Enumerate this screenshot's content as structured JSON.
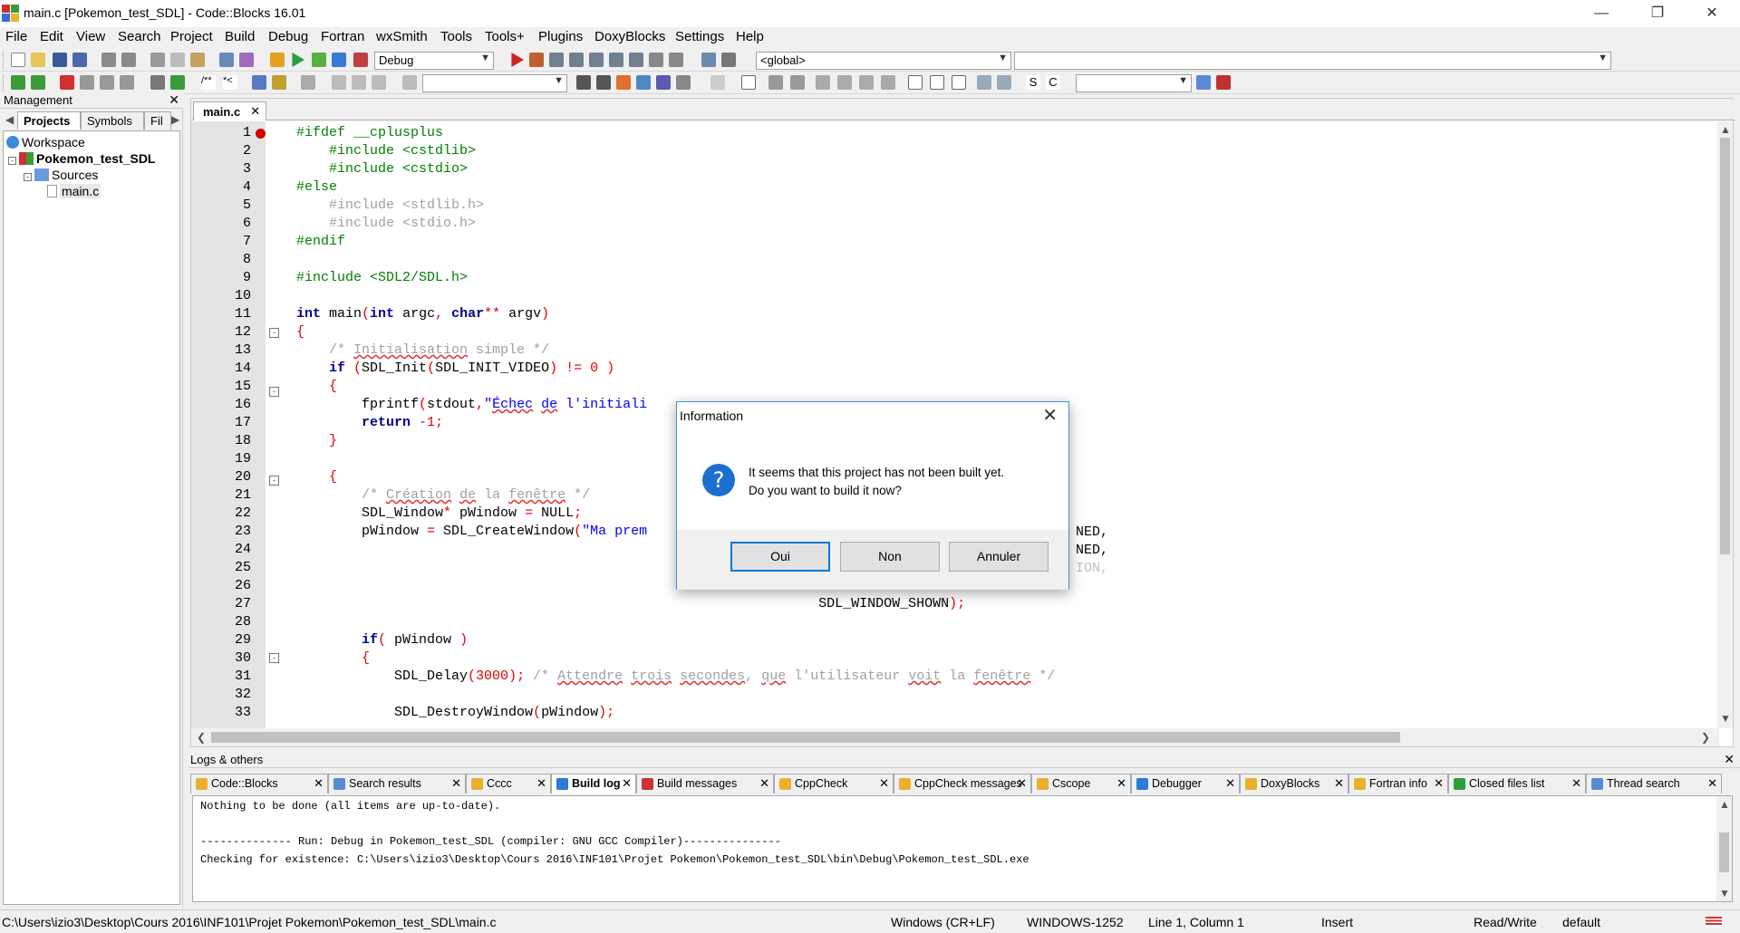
{
  "window": {
    "title": "main.c [Pokemon_test_SDL] - Code::Blocks 16.01"
  },
  "menu": [
    "File",
    "Edit",
    "View",
    "Search",
    "Project",
    "Build",
    "Debug",
    "Fortran",
    "wxSmith",
    "Tools",
    "Tools+",
    "Plugins",
    "DoxyBlocks",
    "Settings",
    "Help"
  ],
  "toolbar": {
    "build_target": "Debug",
    "scope": "<global>",
    "symbol": "",
    "search_combo": "",
    "jump_combo": ""
  },
  "management": {
    "title": "Management",
    "tabs": [
      "Projects",
      "Symbols",
      "Fil"
    ],
    "tree": {
      "workspace": "Workspace",
      "project": "Pokemon_test_SDL",
      "folder": "Sources",
      "file": "main.c"
    }
  },
  "editor": {
    "tab": "main.c",
    "lines": [
      {
        "n": "1",
        "code": [
          [
            "pp",
            "#ifdef __cplusplus"
          ]
        ]
      },
      {
        "n": "2",
        "code": [
          [
            "pp",
            "    #include <cstdlib>"
          ]
        ]
      },
      {
        "n": "3",
        "code": [
          [
            "pp",
            "    #include <cstdio>"
          ]
        ]
      },
      {
        "n": "4",
        "code": [
          [
            "pp",
            "#else"
          ]
        ]
      },
      {
        "n": "5",
        "code": [
          [
            "ppd",
            "    #include <stdlib.h>"
          ]
        ]
      },
      {
        "n": "6",
        "code": [
          [
            "ppd",
            "    #include <stdio.h>"
          ]
        ]
      },
      {
        "n": "7",
        "code": [
          [
            "pp",
            "#endif"
          ]
        ]
      },
      {
        "n": "8",
        "code": []
      },
      {
        "n": "9",
        "code": [
          [
            "pp",
            "#include <SDL2/SDL.h>"
          ]
        ]
      },
      {
        "n": "10",
        "code": []
      },
      {
        "n": "11",
        "code": [
          [
            "kw",
            "int"
          ],
          [
            "id",
            " main"
          ],
          [
            "op",
            "("
          ],
          [
            "kw",
            "int"
          ],
          [
            "id",
            " argc"
          ],
          [
            "op",
            ", "
          ],
          [
            "kw",
            "char"
          ],
          [
            "op",
            "**"
          ],
          [
            "id",
            " argv"
          ],
          [
            "op",
            ")"
          ]
        ]
      },
      {
        "n": "12",
        "code": [
          [
            "op",
            "{"
          ]
        ]
      },
      {
        "n": "13",
        "code": [
          [
            "com",
            "    /* "
          ],
          [
            "com sq",
            "Initialisation"
          ],
          [
            "com",
            " simple */"
          ]
        ]
      },
      {
        "n": "14",
        "code": [
          [
            "id",
            "    "
          ],
          [
            "kw",
            "if"
          ],
          [
            "op",
            " ("
          ],
          [
            "id",
            "SDL_Init"
          ],
          [
            "op",
            "("
          ],
          [
            "id",
            "SDL_INIT_VIDEO"
          ],
          [
            "op",
            ") != "
          ],
          [
            "num",
            "0"
          ],
          [
            "op",
            " )"
          ]
        ]
      },
      {
        "n": "15",
        "code": [
          [
            "op",
            "    {"
          ]
        ]
      },
      {
        "n": "16",
        "code": [
          [
            "id",
            "        fprintf"
          ],
          [
            "op",
            "("
          ],
          [
            "id",
            "stdout"
          ],
          [
            "op",
            ","
          ],
          [
            "str",
            "\""
          ],
          [
            "str sq",
            "Échec"
          ],
          [
            "str",
            " "
          ],
          [
            "str sq",
            "de"
          ],
          [
            "str",
            " l'initiali"
          ]
        ]
      },
      {
        "n": "17",
        "code": [
          [
            "id",
            "        "
          ],
          [
            "kw",
            "return"
          ],
          [
            "op",
            " -"
          ],
          [
            "num",
            "1"
          ],
          [
            "op",
            ";"
          ]
        ]
      },
      {
        "n": "18",
        "code": [
          [
            "op",
            "    }"
          ]
        ]
      },
      {
        "n": "19",
        "code": []
      },
      {
        "n": "20",
        "code": [
          [
            "op",
            "    {"
          ]
        ]
      },
      {
        "n": "21",
        "code": [
          [
            "com",
            "        /* "
          ],
          [
            "com sq",
            "Création"
          ],
          [
            "com",
            " "
          ],
          [
            "com sq",
            "de"
          ],
          [
            "com",
            " la "
          ],
          [
            "com sq",
            "fenêtre"
          ],
          [
            "com",
            " */"
          ]
        ]
      },
      {
        "n": "22",
        "code": [
          [
            "id",
            "        SDL_Window"
          ],
          [
            "op",
            "*"
          ],
          [
            "id",
            " pWindow "
          ],
          [
            "op",
            "="
          ],
          [
            "id",
            " NULL"
          ],
          [
            "op",
            ";"
          ]
        ]
      },
      {
        "n": "23",
        "code": [
          [
            "id",
            "        pWindow "
          ],
          [
            "op",
            "="
          ],
          [
            "id",
            " SDL_CreateWindow"
          ],
          [
            "op",
            "("
          ],
          [
            "str",
            "\"Ma prem"
          ]
        ]
      },
      {
        "n": "24",
        "code": []
      },
      {
        "n": "25",
        "code": []
      },
      {
        "n": "26",
        "code": []
      },
      {
        "n": "27",
        "code": [
          [
            "id",
            "                                                                SDL_WINDOW_SHOWN"
          ],
          [
            "op",
            ");"
          ]
        ]
      },
      {
        "n": "28",
        "code": []
      },
      {
        "n": "29",
        "code": [
          [
            "id",
            "        "
          ],
          [
            "kw",
            "if"
          ],
          [
            "op",
            "("
          ],
          [
            "id",
            " pWindow "
          ],
          [
            "op",
            ")"
          ]
        ]
      },
      {
        "n": "30",
        "code": [
          [
            "op",
            "        {"
          ]
        ]
      },
      {
        "n": "31",
        "code": [
          [
            "id",
            "            SDL_Delay"
          ],
          [
            "op",
            "("
          ],
          [
            "num",
            "3000"
          ],
          [
            "op",
            ");"
          ],
          [
            "com",
            " /* "
          ],
          [
            "com sq",
            "Attendre"
          ],
          [
            "com",
            " "
          ],
          [
            "com sq",
            "trois"
          ],
          [
            "com",
            " "
          ],
          [
            "com sq",
            "secondes"
          ],
          [
            "com",
            ", "
          ],
          [
            "com sq",
            "que"
          ],
          [
            "com",
            " l'utilisateur "
          ],
          [
            "com sq",
            "voit"
          ],
          [
            "com",
            " la "
          ],
          [
            "com sq",
            "fenêtre"
          ],
          [
            "com",
            " */"
          ]
        ]
      },
      {
        "n": "32",
        "code": []
      },
      {
        "n": "33",
        "code": [
          [
            "id",
            "            SDL_DestroyWindow"
          ],
          [
            "op",
            "("
          ],
          [
            "id",
            "pWindow"
          ],
          [
            "op",
            ");"
          ]
        ]
      }
    ],
    "fragments": {
      "l23": "NED,",
      "l24": "NED,",
      "l26": "ION,"
    }
  },
  "dialog": {
    "title": "Information",
    "line1": "It seems that this project has not been built yet.",
    "line2": "Do you want to build it now?",
    "icon": "?",
    "buttons": {
      "yes": "Oui",
      "no": "Non",
      "cancel": "Annuler"
    }
  },
  "logs": {
    "title": "Logs & others",
    "tabs": [
      {
        "label": "Code::Blocks",
        "color": "#e8b030"
      },
      {
        "label": "Search results",
        "color": "#5a8ad6"
      },
      {
        "label": "Cccc",
        "color": "#e8b030"
      },
      {
        "label": "Build log",
        "color": "#2a7ad6",
        "active": true
      },
      {
        "label": "Build messages",
        "color": "#d03030"
      },
      {
        "label": "CppCheck",
        "color": "#e8b030"
      },
      {
        "label": "CppCheck messages",
        "color": "#e8b030"
      },
      {
        "label": "Cscope",
        "color": "#e8b030"
      },
      {
        "label": "Debugger",
        "color": "#2a7ad6"
      },
      {
        "label": "DoxyBlocks",
        "color": "#e8b030"
      },
      {
        "label": "Fortran info",
        "color": "#e8b030"
      },
      {
        "label": "Closed files list",
        "color": "#2aa040"
      },
      {
        "label": "Thread search",
        "color": "#5a8ad6"
      }
    ],
    "lines": [
      "Nothing to be done (all items are up-to-date).",
      "",
      "-------------- Run: Debug in Pokemon_test_SDL (compiler: GNU GCC Compiler)---------------",
      "Checking for existence: C:\\Users\\izio3\\Desktop\\Cours 2016\\INF101\\Projet Pokemon\\Pokemon_test_SDL\\bin\\Debug\\Pokemon_test_SDL.exe"
    ]
  },
  "status": {
    "path": "C:\\Users\\izio3\\Desktop\\Cours 2016\\INF101\\Projet Pokemon\\Pokemon_test_SDL\\main.c",
    "eol": "Windows (CR+LF)",
    "encoding": "WINDOWS-1252",
    "position": "Line 1, Column 1",
    "mode": "Insert",
    "access": "Read/Write",
    "lang": "default"
  }
}
